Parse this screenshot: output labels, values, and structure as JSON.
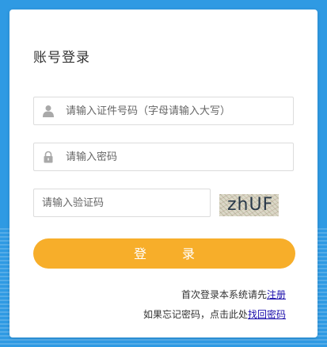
{
  "title": "账号登录",
  "username": {
    "placeholder": "请输入证件号码（字母请输入大写）",
    "value": ""
  },
  "password": {
    "placeholder": "请输入密码",
    "value": ""
  },
  "captcha": {
    "placeholder": "请输入验证码",
    "value": "",
    "image_text": "zhUF"
  },
  "login_button": "登 录",
  "register_hint": {
    "text": "首次登录本系统请先",
    "link": "注册"
  },
  "forgot_hint": {
    "text": "如果忘记密码，点击此处",
    "link": "找回密码"
  },
  "icons": {
    "username": "user-icon",
    "password": "lock-icon"
  },
  "colors": {
    "background": "#2f9ae3",
    "button": "#f7ae2a",
    "link": "#1a0dab"
  }
}
